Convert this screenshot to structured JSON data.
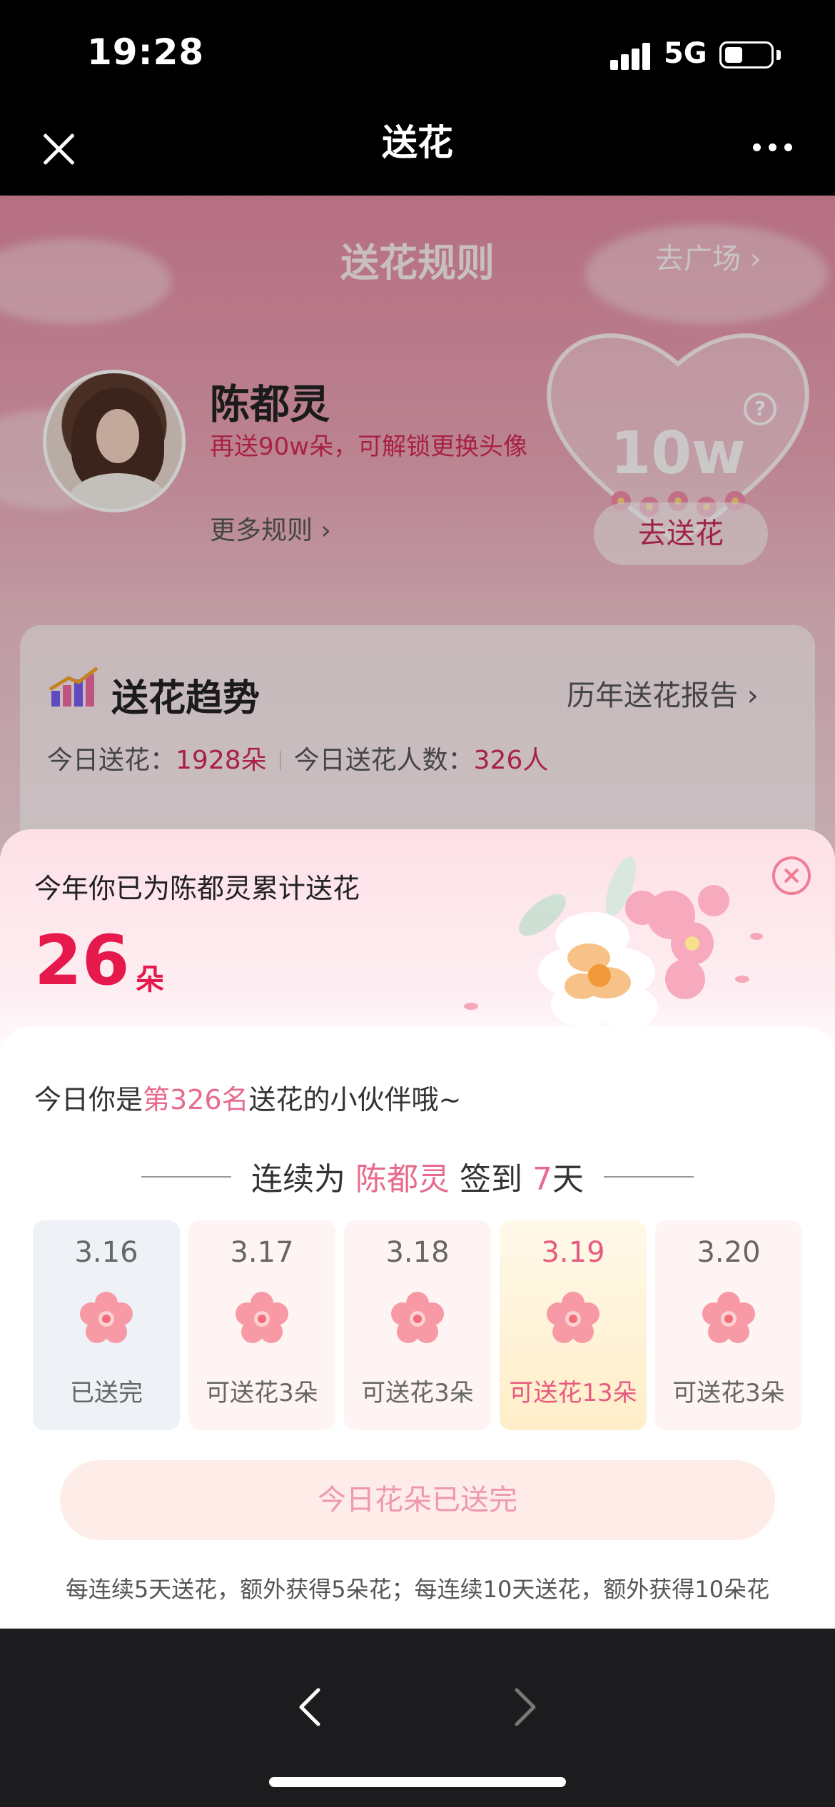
{
  "status_bar": {
    "time": "19:28",
    "network": "5G"
  },
  "nav": {
    "title": "送花",
    "close_icon": "close-icon",
    "more_icon": "more-icon"
  },
  "page": {
    "rules_title": "送花规则",
    "to_square": "去广场 ›",
    "user_name": "陈都灵",
    "unlock_tip": "再送90w朵，可解锁更换头像",
    "more_rules": "更多规则 ›",
    "heart_count": "10w",
    "send_button": "去送花",
    "trend": {
      "title": "送花趋势",
      "report_link": "历年送花报告 ›",
      "today_label": "今日送花：",
      "today_value": "1928朵",
      "people_label": "今日送花人数：",
      "people_value": "326人"
    }
  },
  "sheet": {
    "total_label": "今年你已为陈都灵累计送花",
    "total_count": "26",
    "total_unit": "朵",
    "rank_prefix": "今日你是",
    "rank_highlight": "第326名",
    "rank_suffix": "送花的小伙伴哦~",
    "streak_prefix": "连续为",
    "streak_name": "陈都灵",
    "streak_mid": "签到",
    "streak_days": "7",
    "streak_suffix": "天",
    "days": [
      {
        "date": "3.16",
        "status": "已送完"
      },
      {
        "date": "3.17",
        "status": "可送花3朵"
      },
      {
        "date": "3.18",
        "status": "可送花3朵"
      },
      {
        "date": "3.19",
        "status": "可送花13朵"
      },
      {
        "date": "3.20",
        "status": "可送花3朵"
      }
    ],
    "done_button": "今日花朵已送完",
    "bonus_tip": "每连续5天送花，额外获得5朵花；每连续10天送花，额外获得10朵花"
  },
  "colors": {
    "accent": "#e5194c",
    "highlight": "#e86b8e",
    "background_pink": "#f0c3cc"
  }
}
